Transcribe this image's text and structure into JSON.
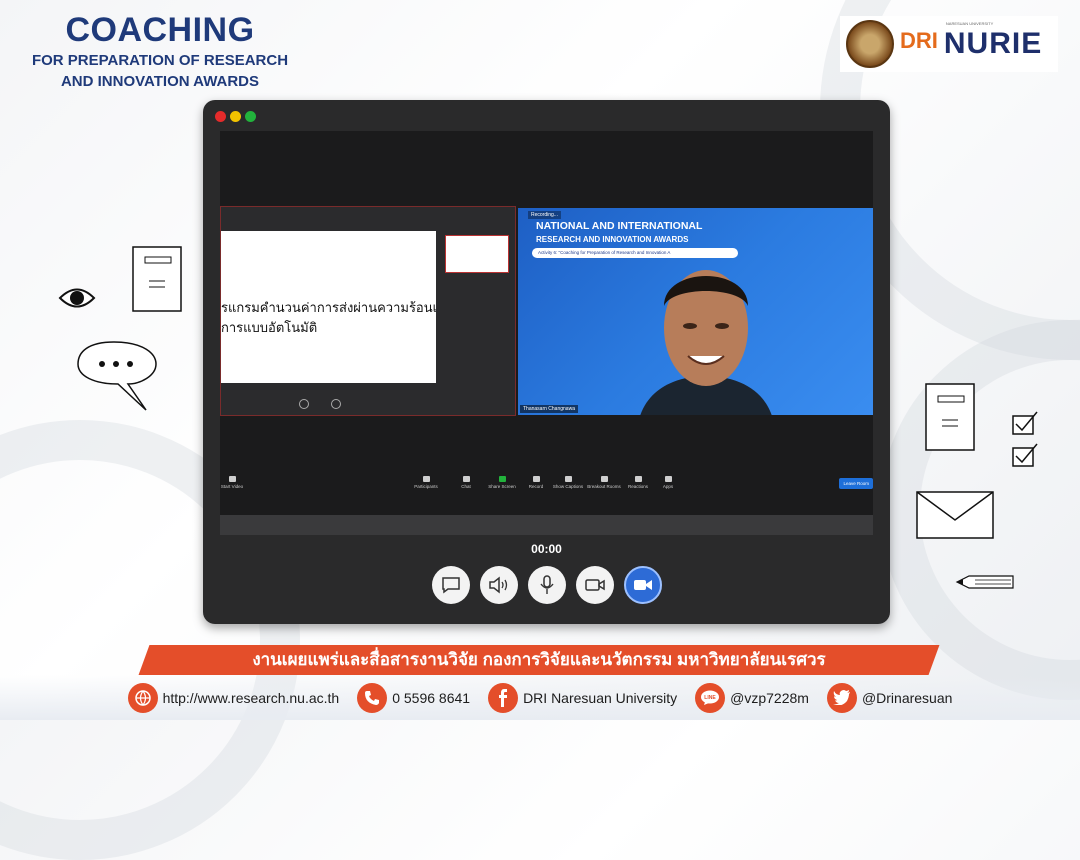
{
  "brand": {
    "title": "COACHING",
    "subtitle_line1": "FOR PREPARATION OF RESEARCH",
    "subtitle_line2": "AND INNOVATION AWARDS"
  },
  "logos": {
    "dri": "DRI",
    "nurie": "NURIE",
    "nurie_caption": "NARESUAN UNIVERSITY"
  },
  "meeting": {
    "slide_text_line1": "รแกรมคำนวนค่าการส่งผ่านความร้อนเข้าสู่ตัว",
    "slide_text_line2": "การแบบอัตโนมัติ",
    "video_heading1": "NATIONAL AND INTERNATIONAL",
    "video_heading2": "RESEARCH AND INNOVATION AWARDS",
    "video_band": "Activity 6: \"Coaching for Preparation of Research and Innovation A",
    "recording_label": "Recording...",
    "participant_name": "Thanasarn Changnawa",
    "toolbar": [
      {
        "label": "Participants"
      },
      {
        "label": "Chat"
      },
      {
        "label": "Share Screen"
      },
      {
        "label": "Record"
      },
      {
        "label": "Show Captions"
      },
      {
        "label": "Breakout Rooms"
      },
      {
        "label": "Reactions"
      },
      {
        "label": "Apps"
      }
    ],
    "start_video_label": "Start Video",
    "leave_label": "Leave Room"
  },
  "player": {
    "timer": "00:00",
    "controls": [
      "chat-icon",
      "speaker-icon",
      "microphone-icon",
      "camera-icon",
      "video-call-icon"
    ]
  },
  "banner": {
    "text": "งานเผยแพร่และสื่อสารงานวิจัย กองการวิจัยและนวัตกรรม มหาวิทยาลัยนเรศวร"
  },
  "footer": {
    "website": "http://www.research.nu.ac.th",
    "phone": "0 5596 8641",
    "facebook": "DRI Naresuan University",
    "line": "@vzp7228m",
    "twitter": "@Drinaresuan"
  },
  "colors": {
    "brand_blue": "#1f3a7a",
    "accent_orange": "#e44e2a",
    "zoom_blue": "#2d6bd6"
  }
}
